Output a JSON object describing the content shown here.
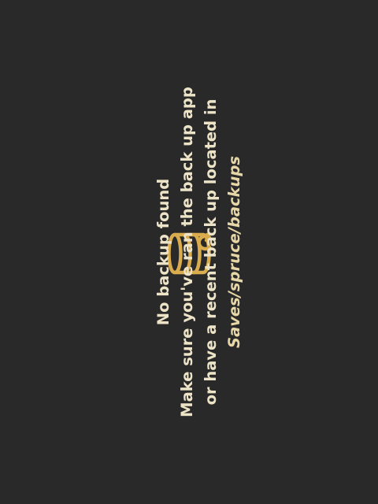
{
  "empty_state": {
    "icon": "database-restore-icon",
    "accent_color": "#d9ac4e",
    "background_color": "#292929",
    "title": "No backup found",
    "line1": "Make sure you've ran the back up app",
    "line2": "or have a recent back up located in",
    "path": "Saves/spruce/backups"
  }
}
